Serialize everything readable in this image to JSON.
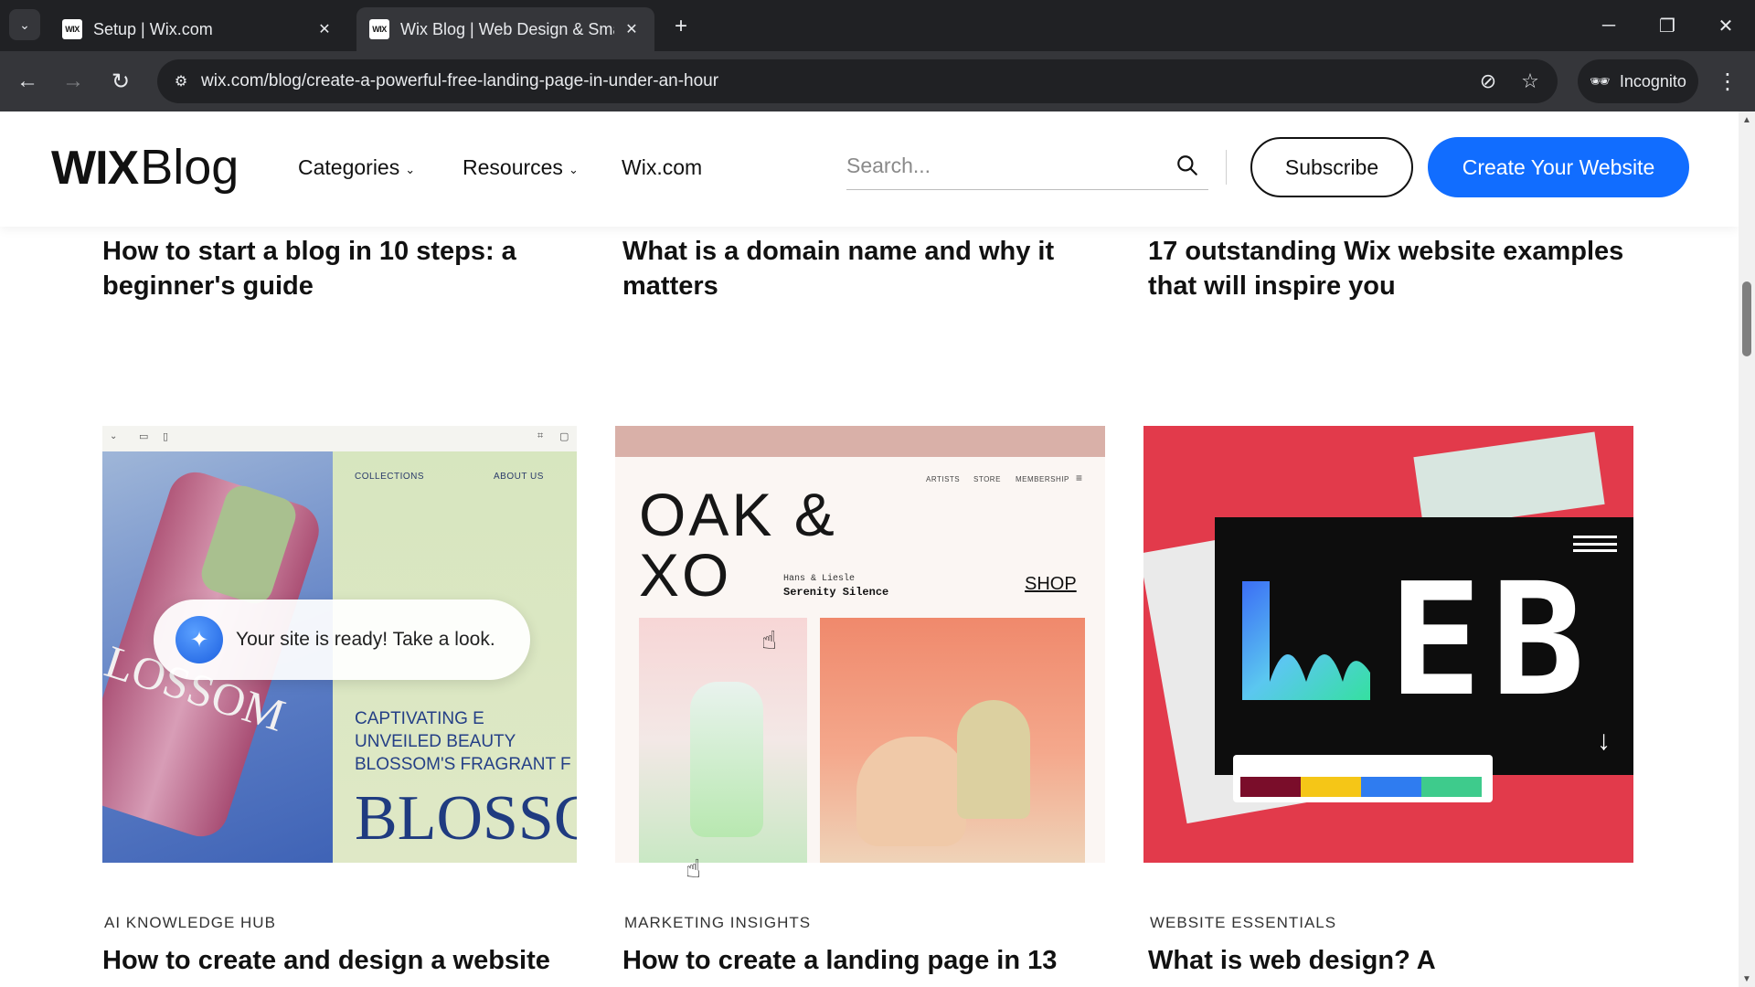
{
  "browser": {
    "tabs": [
      {
        "title": "Setup | Wix.com",
        "favicon": "WIX",
        "active": false
      },
      {
        "title": "Wix Blog | Web Design & Small",
        "favicon": "WIX",
        "active": true
      }
    ],
    "url": "wix.com/blog/create-a-powerful-free-landing-page-in-under-an-hour",
    "incognito_label": "Incognito",
    "icons": {
      "tab_list": "chevron-down-icon",
      "new_tab": "plus-icon",
      "back": "back-arrow-icon",
      "forward": "forward-arrow-icon",
      "reload": "reload-icon",
      "site_info": "tune-icon",
      "eye_off": "eye-off-icon",
      "bookmark": "star-icon",
      "menu": "kebab-menu-icon"
    }
  },
  "header": {
    "logo_wix": "WIX",
    "logo_blog": "Blog",
    "nav": [
      {
        "label": "Categories",
        "has_dropdown": true
      },
      {
        "label": "Resources",
        "has_dropdown": true
      },
      {
        "label": "Wix.com",
        "has_dropdown": false
      }
    ],
    "search_placeholder": "Search...",
    "subscribe_label": "Subscribe",
    "create_label": "Create Your Website",
    "colors": {
      "accent": "#116dff"
    }
  },
  "top_row": [
    {
      "title_line1": "How to start a blog in 10 steps: a",
      "title_line2": "beginner's guide"
    },
    {
      "title_line1": "What is a domain name and why it",
      "title_line2": "matters"
    },
    {
      "title_line1": "17 outstanding Wix website examples",
      "title_line2": "that will inspire you"
    }
  ],
  "cards": [
    {
      "category": "AI KNOWLEDGE HUB",
      "title": "How to create and design a website",
      "thumb": {
        "nav1": "COLLECTIONS",
        "nav2": "ABOUT US",
        "toast": "Your site is ready! Take a look.",
        "caption_lines": [
          "CAPTIVATING E",
          "UNVEILED BEAUTY",
          "BLOSSOM'S FRAGRANT F"
        ],
        "big_text": "BLOSSC",
        "bottle_text": "LOSSOM"
      }
    },
    {
      "category": "MARKETING INSIGHTS",
      "title": "How to create a landing page in 13",
      "thumb": {
        "nav": [
          "ARTISTS",
          "STORE",
          "MEMBERSHIP"
        ],
        "brand_line1": "OAK &",
        "brand_line2": "XO",
        "sub1": "Hans & Liesle",
        "sub2": "Serenity Silence",
        "shop": "SHOP"
      }
    },
    {
      "category": "WEBSITE ESSENTIALS",
      "title": "What is web design? A",
      "thumb": {
        "big_text": "EB",
        "palette_colors": [
          "#7a0d2a",
          "#f5c617",
          "#2f7cf0",
          "#3ecb8c"
        ]
      }
    }
  ]
}
